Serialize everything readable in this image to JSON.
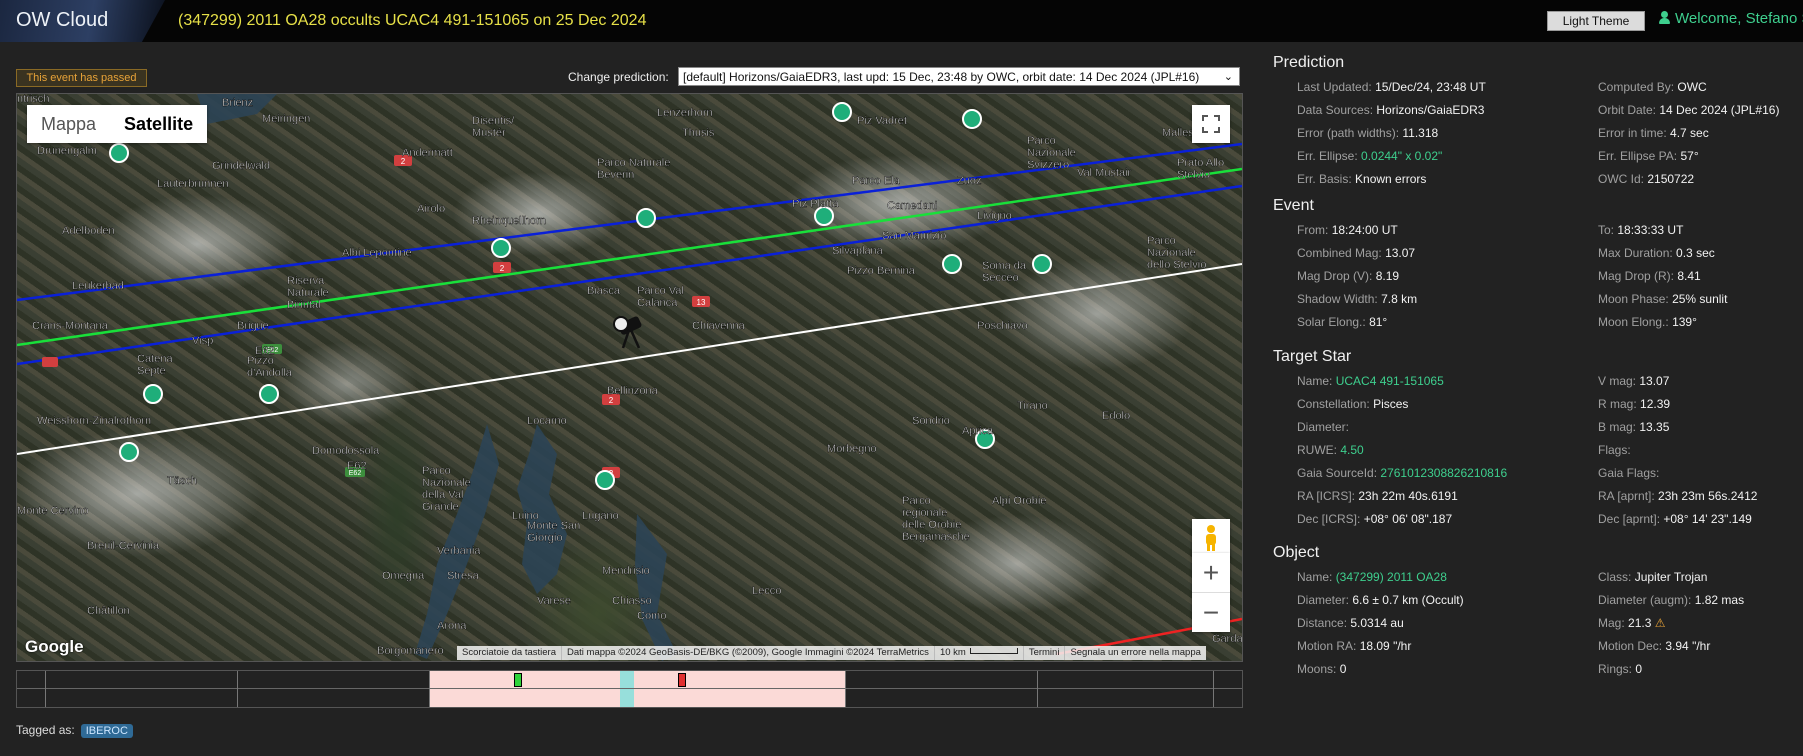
{
  "header": {
    "logo": "OW Cloud",
    "event_title": "(347299) 2011 OA28 occults UCAC4 491-151065 on 25 Dec 2024",
    "theme_button": "Light Theme",
    "welcome": "Welcome, Stefano S"
  },
  "toolbar": {
    "passed_label": "This event has passed",
    "change_prediction_label": "Change prediction:",
    "prediction_select_value": "[default] Horizons/GaiaEDR3, last upd: 15 Dec, 23:48 by OWC, orbit date: 14 Dec 2024 (JPL#16)"
  },
  "map": {
    "type_map": "Mappa",
    "type_satellite": "Satellite",
    "google": "Google",
    "attribution": {
      "shortcuts": "Scorciatoie da tastiera",
      "data": "Dati mappa ©2024 GeoBasis-DE/BKG (©2009), Google Immagini ©2024 TerraMetrics",
      "scale": "10 km",
      "terms": "Termini",
      "report": "Segnala un errore nella mappa"
    },
    "labels": [
      "ntrisch",
      "Brienz",
      "Meiringen",
      "Disentis/\nMustér",
      "Lenzerhorn",
      "Piz Vadret",
      "Drunengalm",
      "Andermatt",
      "Thusis",
      "Parco Naturale\nBeverin",
      "Parco\nNazionale\nSvizzero",
      "Malles Vel",
      "Grindelwald",
      "Lauterbrunnen",
      "Parco Ela",
      "Zuoz",
      "Prato Allo\nStelvio",
      "Val Mustair",
      "Airolo",
      "Piz Platta",
      "Camedani",
      "Rheinquellhorn",
      "Livigno",
      "Adelboden",
      "San Maurizio",
      "Silvaplana",
      "Albi Lepontine",
      "Parco\nNazionale\ndello Stelvio",
      "Pizzo Bernina",
      "Soma da\nSecceo",
      "Leukerbad",
      "Riserva\nNaturale\nBirintal",
      "Biasca",
      "Parco Val\nCalanca",
      "Crans-Montana",
      "Chiavenna",
      "Poschiavo",
      "Brigue",
      "Visp",
      "E62",
      "Tirano",
      "Catena\nSepte",
      "Pizzo\nd'Andolla",
      "Bellinzona",
      "Locarno",
      "Edolo",
      "Sondrio",
      "Weisshorn-Zinalrothorn",
      "Aprica",
      "Domodossola",
      "Morbegno",
      "Täsch",
      "Parco\nNazionale\ndella Val\nGrande",
      "E62",
      "Alpi Orobie",
      "Monte Cervino",
      "Luino",
      "Lugano",
      "Verbania",
      "Parco\nregionale\ndelle Orobie\nBergamasche",
      "Breuil-Cervinia",
      "Monte San\nGiorgio",
      "Omegna",
      "Stresa",
      "Mendrisio",
      "Varese",
      "Chiasso",
      "Lecco",
      "Como",
      "Châtillon",
      "Arona",
      "Borgomanero",
      "Garda"
    ]
  },
  "timeline": {},
  "tags": {
    "label": "Tagged as:",
    "badge": "IBEROC"
  },
  "panel": {
    "prediction": {
      "title": "Prediction",
      "left": [
        {
          "k": "Last Updated:",
          "v": "15/Dec/24, 23:48 UT"
        },
        {
          "k": "Data Sources:",
          "v": "Horizons/GaiaEDR3"
        },
        {
          "k": "Error (path widths):",
          "v": "11.318"
        },
        {
          "k": "Err. Ellipse:",
          "v": "0.0244\" x 0.02\""
        },
        {
          "k": "Err. Basis:",
          "v": "Known errors"
        }
      ],
      "right": [
        {
          "k": "Computed By:",
          "v": "OWC"
        },
        {
          "k": "Orbit Date:",
          "v": "14 Dec 2024 (JPL#16)"
        },
        {
          "k": "Error in time:",
          "v": "4.7 sec"
        },
        {
          "k": "Err. Ellipse PA:",
          "v": "57°"
        },
        {
          "k": "OWC Id:",
          "v": "2150722"
        }
      ]
    },
    "event": {
      "title": "Event",
      "left": [
        {
          "k": "From:",
          "v": "18:24:00 UT"
        },
        {
          "k": "Combined Mag:",
          "v": "13.07"
        },
        {
          "k": "Mag Drop (V):",
          "v": "8.19"
        },
        {
          "k": "Shadow Width:",
          "v": "7.8 km"
        },
        {
          "k": "Solar Elong.:",
          "v": "81°"
        }
      ],
      "right": [
        {
          "k": "To:",
          "v": "18:33:33 UT"
        },
        {
          "k": "Max Duration:",
          "v": "0.3 sec"
        },
        {
          "k": "Mag Drop (R):",
          "v": "8.41"
        },
        {
          "k": "Moon Phase:",
          "v": "25% sunlit"
        },
        {
          "k": "Moon Elong.:",
          "v": "139°"
        }
      ]
    },
    "target": {
      "title": "Target Star",
      "left": [
        {
          "k": "Name:",
          "v": "UCAC4 491-151065"
        },
        {
          "k": "Constellation:",
          "v": "Pisces"
        },
        {
          "k": "Diameter:",
          "v": ""
        },
        {
          "k": "RUWE:",
          "v": "4.50"
        },
        {
          "k": "Gaia SourceId:",
          "v": "2761012308826210816"
        },
        {
          "k": "RA [ICRS]:",
          "v": "23h 22m 40s.6191"
        },
        {
          "k": "Dec [ICRS]:",
          "v": "+08° 06' 08\".187"
        }
      ],
      "right": [
        {
          "k": "V mag:",
          "v": "13.07"
        },
        {
          "k": "R mag:",
          "v": "12.39"
        },
        {
          "k": "B mag:",
          "v": "13.35"
        },
        {
          "k": "Flags:",
          "v": ""
        },
        {
          "k": "Gaia Flags:",
          "v": ""
        },
        {
          "k": "RA [aprnt]:",
          "v": "23h 23m 56s.2412"
        },
        {
          "k": "Dec [aprnt]:",
          "v": "+08° 14' 23\".149"
        }
      ]
    },
    "object": {
      "title": "Object",
      "left": [
        {
          "k": "Name:",
          "v": "(347299) 2011 OA28"
        },
        {
          "k": "Diameter:",
          "v": "6.6 ± 0.7 km (Occult)"
        },
        {
          "k": "Distance:",
          "v": "5.0314 au"
        },
        {
          "k": "Motion RA:",
          "v": "18.09 \"/hr"
        },
        {
          "k": "Moons:",
          "v": "0"
        }
      ],
      "right": [
        {
          "k": "Class:",
          "v": "Jupiter Trojan"
        },
        {
          "k": "Diameter (augm):",
          "v": "1.82 mas"
        },
        {
          "k": "Mag:",
          "v": "21.3"
        },
        {
          "k": "Motion Dec:",
          "v": "3.94 \"/hr"
        },
        {
          "k": "Rings:",
          "v": "0"
        }
      ]
    }
  },
  "colors": {
    "accent_green": "#3ecf8e",
    "title_yellow": "#e6e048",
    "warning": "#e8a338",
    "path_center": "#00dd33",
    "path_limits": "#0a20d8",
    "path_sigma": "#ffffff"
  }
}
